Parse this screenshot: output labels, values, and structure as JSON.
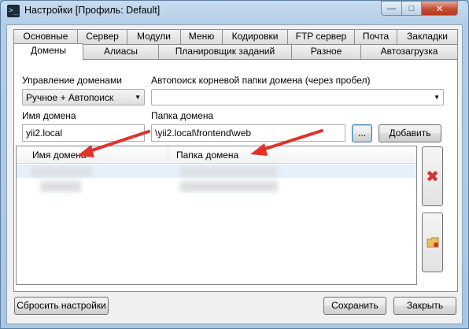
{
  "window": {
    "title": "Настройки [Профиль: Default]",
    "app_icon_glyph": ">_",
    "minimize_glyph": "—",
    "maximize_glyph": "□",
    "close_glyph": "✕"
  },
  "tabs_row1": [
    "Основные",
    "Сервер",
    "Модули",
    "Меню",
    "Кодировки",
    "FTP сервер",
    "Почта",
    "Закладки"
  ],
  "tabs_row2": [
    "Домены",
    "Алиасы",
    "Планировщик заданий",
    "Разное",
    "Автозагрузка"
  ],
  "active_tab": "Домены",
  "domains": {
    "management_label": "Управление доменами",
    "management_value": "Ручное + Автопоиск",
    "autosearch_label": "Автопоиск корневой папки домена (через пробел)",
    "autosearch_value": "",
    "domain_name_label": "Имя домена",
    "domain_name_value": "yii2.local",
    "domain_folder_label": "Папка домена",
    "domain_folder_value": "\\yii2.local\\frontend\\web",
    "browse_label": "...",
    "add_label": "Добавить",
    "columns": [
      "Имя домена",
      "Папка домена"
    ]
  },
  "footer": {
    "reset_label": "Сбросить настройки",
    "save_label": "Сохранить",
    "close_label": "Закрыть"
  },
  "colors": {
    "annotation_arrow": "#e0332b",
    "delete_icon": "#d9302a",
    "folder_icon": "#e8c060"
  },
  "icons": [
    "app-icon",
    "dropdown-arrow-icon",
    "delete-icon",
    "folder-icon",
    "arrow-annotation-icon"
  ]
}
